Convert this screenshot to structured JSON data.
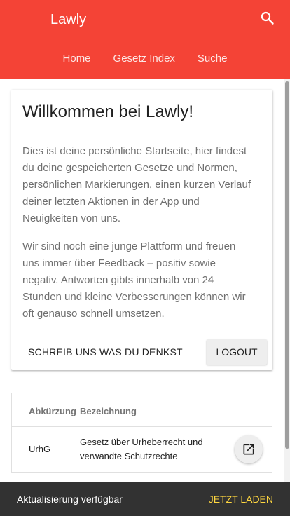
{
  "app": {
    "title": "Lawly"
  },
  "header": {
    "search_icon": "search-icon",
    "nav": [
      "Home",
      "Gesetz Index",
      "Suche"
    ]
  },
  "welcome_card": {
    "title": "Willkommen bei Lawly!",
    "paragraph_1": "Dies ist deine persönliche Startseite, hier findest du deine gespeicherten Gesetze und Normen, persönlichen Markierungen, einen kurzen Verlauf deiner letzten Aktionen in der App und Neuigkeiten von uns.",
    "paragraph_2": "Wir sind noch eine junge Plattform und freuen uns immer über Feedback – positiv sowie negativ. Antworten gibts innerhalb von 24 Stunden und kleine Verbesserungen können wir oft genauso schnell umsetzen.",
    "feedback_button": "Schreib uns was du denkst",
    "logout_button": "Logout"
  },
  "laws_table": {
    "columns": [
      "Abkürzung",
      "Bezeichnung"
    ],
    "rows": [
      {
        "abbreviation": "UrhG",
        "name": "Gesetz über Urheberrecht und verwandte Schutzrechte",
        "action_icon": "open-in-new-icon"
      }
    ]
  },
  "snackbar": {
    "message": "Aktualisierung verfügbar",
    "action": "Jetzt laden"
  },
  "colors": {
    "primary": "#f44336",
    "snackbar_bg": "#323232",
    "snackbar_action": "#ffd740"
  }
}
